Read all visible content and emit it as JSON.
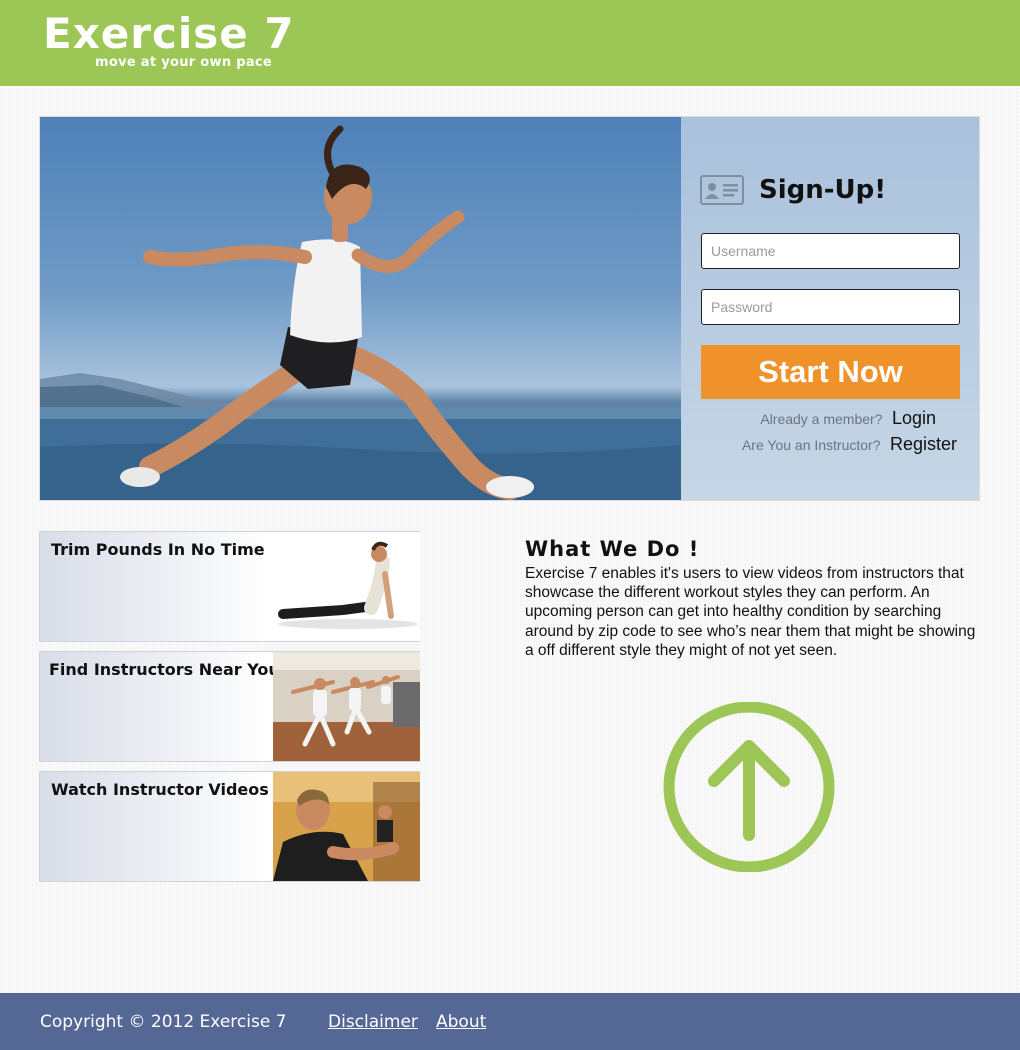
{
  "header": {
    "title": "Exercise 7",
    "tagline": "move at your own pace"
  },
  "signup": {
    "title": "Sign-Up!",
    "username_placeholder": "Username",
    "password_placeholder": "Password",
    "button_label": "Start Now",
    "member_question": "Already a member?",
    "login_link": "Login",
    "instructor_question": "Are You an Instructor?",
    "register_link": "Register",
    "card_icon": "id-card-icon"
  },
  "features": [
    {
      "label": "Trim Pounds In No Time",
      "icon": "yoga-pose-photo"
    },
    {
      "label": "Find Instructors Near You",
      "icon": "group-class-photo"
    },
    {
      "label": "Watch Instructor Videos",
      "icon": "instructor-photo"
    }
  ],
  "about": {
    "title": "What We Do !",
    "body": "Exercise 7 enables it's users to view videos from instructors that showcase the different workout styles they can perform. An upcoming person can get into healthy condition by searching around by zip code to see who’s near them that might be showing a off different style they might of not yet seen."
  },
  "footer": {
    "copyright": "Copyright © 2012 Exercise 7",
    "disclaimer": "Disclaimer",
    "about": "About"
  },
  "colors": {
    "header_green": "#9cc656",
    "accent_orange": "#f0922a",
    "footer_blue": "#556795",
    "arrow_green": "#9cc656"
  }
}
